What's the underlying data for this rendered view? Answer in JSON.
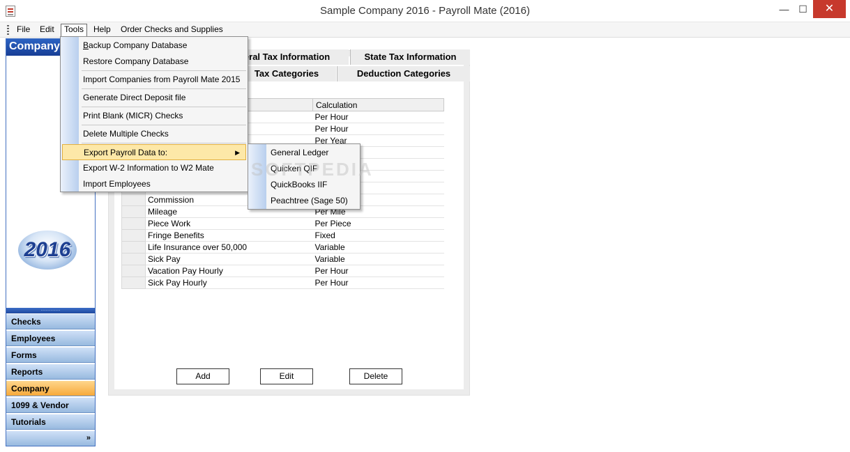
{
  "window": {
    "title": "Sample Company 2016 - Payroll Mate (2016)",
    "minimize": "—",
    "maximize": "☐",
    "close": "✕"
  },
  "menubar": {
    "file": "File",
    "edit": "Edit",
    "tools": "Tools",
    "help": "Help",
    "order": "Order Checks and Supplies"
  },
  "sidebar": {
    "header": "Company",
    "badge": "2016",
    "splitter": "…………",
    "nav": [
      {
        "label": "Checks"
      },
      {
        "label": "Employees"
      },
      {
        "label": "Forms"
      },
      {
        "label": "Reports"
      },
      {
        "label": "Company",
        "selected": true
      },
      {
        "label": "1099 & Vendor"
      },
      {
        "label": "Tutorials"
      }
    ],
    "footer": "»"
  },
  "tabs": {
    "federal": "Federal Tax Information",
    "state": "State Tax Information",
    "tax_categories": "Tax Categories",
    "deduction_categories": "Deduction Categories"
  },
  "grid": {
    "columns": [
      "",
      "",
      "Calculation"
    ],
    "rows": [
      {
        "name": "",
        "calc": "Per Hour"
      },
      {
        "name": "",
        "calc": "Per Hour"
      },
      {
        "name": "",
        "calc": "Per Year"
      },
      {
        "name": "",
        "calc": ""
      },
      {
        "name": "",
        "calc": ""
      },
      {
        "name": "",
        "calc": ""
      },
      {
        "name": "",
        "calc": ""
      },
      {
        "name": "Commission",
        "calc": ""
      },
      {
        "name": "Mileage",
        "calc": "Per Mile"
      },
      {
        "name": "Piece Work",
        "calc": "Per Piece"
      },
      {
        "name": "Fringe Benefits",
        "calc": "Fixed"
      },
      {
        "name": "Life Insurance over 50,000",
        "calc": "Variable"
      },
      {
        "name": "Sick Pay",
        "calc": "Variable"
      },
      {
        "name": "Vacation Pay Hourly",
        "calc": "Per Hour"
      },
      {
        "name": "Sick Pay Hourly",
        "calc": "Per Hour"
      }
    ]
  },
  "buttons": {
    "add": "Add",
    "edit": "Edit",
    "delete": "Delete"
  },
  "tools_menu": {
    "backup": "Backup Company Database",
    "restore": "Restore Company Database",
    "import_companies": "Import Companies from Payroll Mate 2015",
    "direct_deposit": "Generate Direct Deposit file",
    "print_blank": "Print Blank (MICR) Checks",
    "delete_multiple": "Delete Multiple Checks",
    "export_payroll": "Export Payroll Data to:",
    "export_w2": "Export W-2 Information to W2 Mate",
    "import_employees": "Import Employees"
  },
  "export_submenu": {
    "general_ledger": "General Ledger",
    "quicken": "Quicken QIF",
    "quickbooks": "QuickBooks IIF",
    "peachtree": "Peachtree (Sage 50)"
  },
  "watermark": "SOFTPEDIA"
}
